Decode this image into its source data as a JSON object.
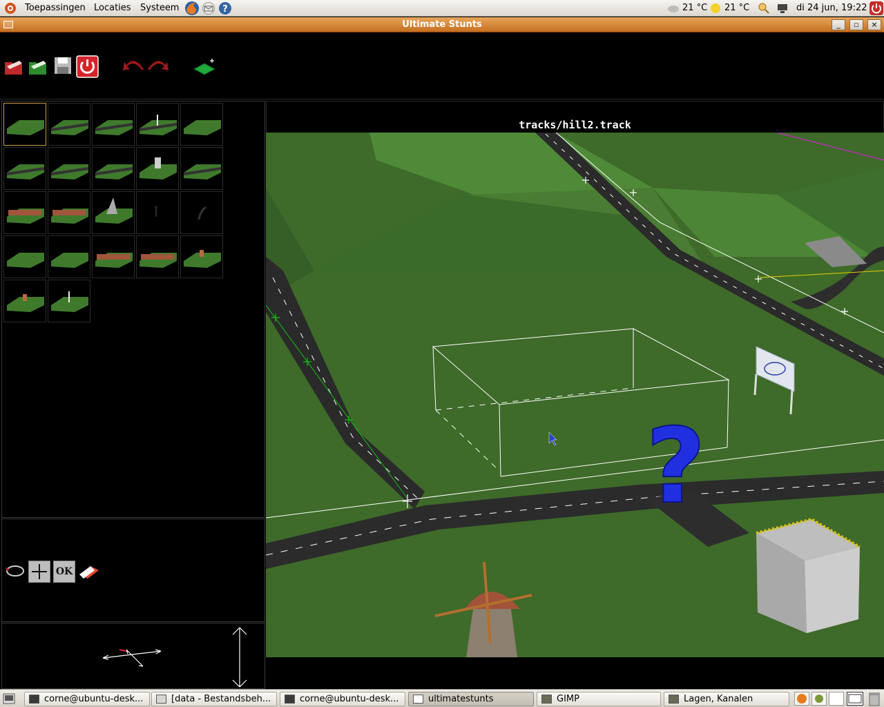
{
  "top_panel": {
    "menus": [
      "Toepassingen",
      "Locaties",
      "Systeem"
    ],
    "weather1": "21 °C",
    "weather2": "21 °C",
    "clock": "di 24 jun, 19:22"
  },
  "window": {
    "title": "Ultimate Stunts"
  },
  "editor": {
    "track_path": "tracks/hill2.track",
    "ok_label": "OK",
    "toolbar_icons": [
      "open-icon",
      "import-icon",
      "save-icon",
      "quit-icon",
      "undo-icon",
      "redo-icon",
      "add-tile-icon"
    ],
    "tile_rows": 5
  },
  "taskbar": {
    "tasks": [
      "corne@ubuntu-desk...",
      "[data - Bestandsbeh...",
      "corne@ubuntu-desk...",
      "ultimatestunts",
      "GIMP",
      "Lagen, Kanalen"
    ],
    "active_index": 3
  },
  "colors": {
    "window_title": "#d3822f",
    "grass": "#3e6a2a",
    "road": "#2a2a2a",
    "question_mark": "#2030e0"
  }
}
